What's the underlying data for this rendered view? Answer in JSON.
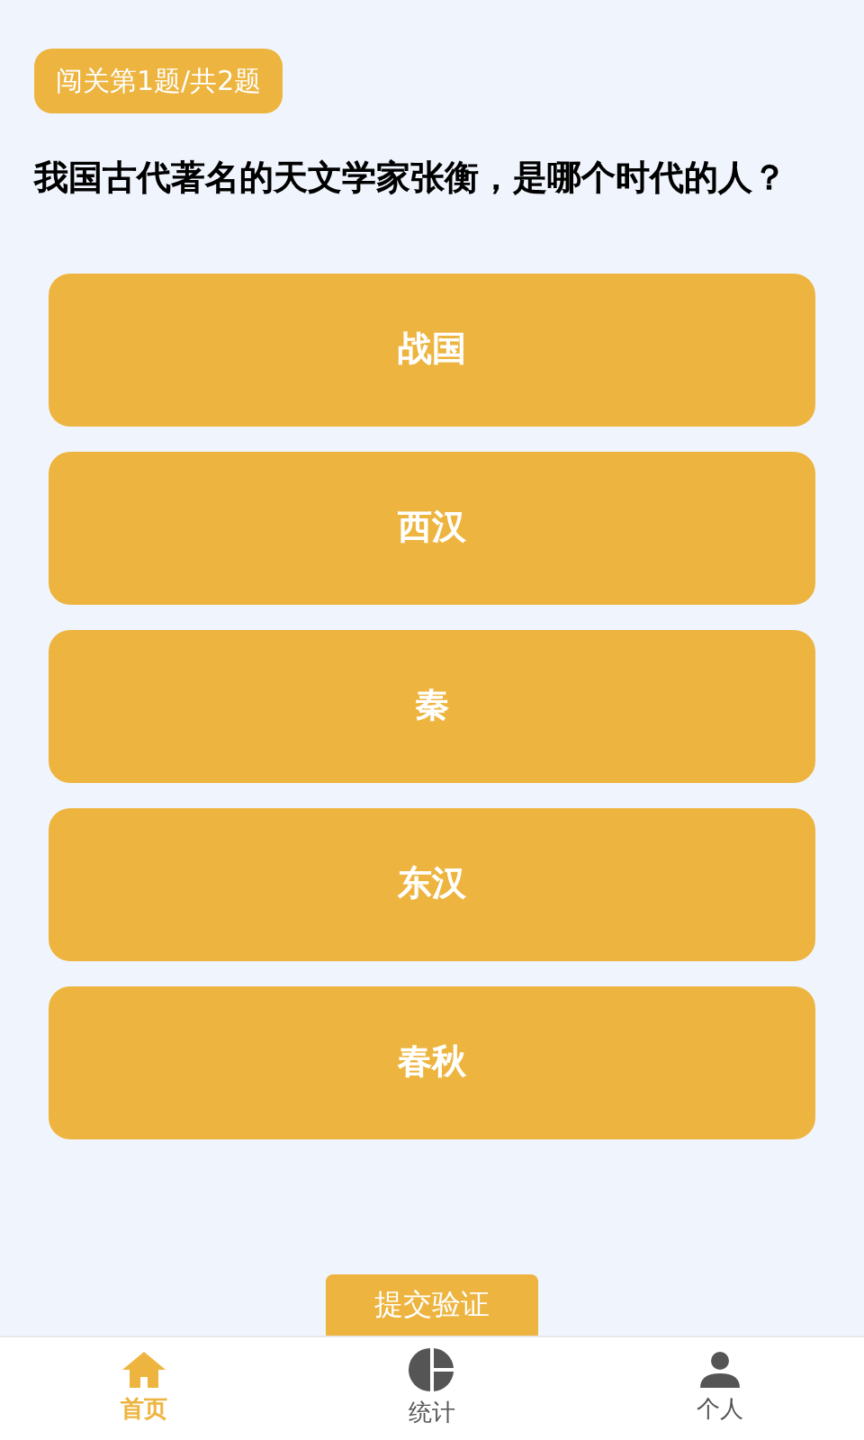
{
  "progress_badge": "闯关第1题/共2题",
  "question": "我国古代著名的天文学家张衡，是哪个时代的人？",
  "options": [
    {
      "label": "战国",
      "selected": false
    },
    {
      "label": "西汉",
      "selected": false
    },
    {
      "label": "秦",
      "selected": false
    },
    {
      "label": "东汉",
      "selected": false
    },
    {
      "label": "春秋",
      "selected": false
    }
  ],
  "submit_button": "提交验证",
  "tab_bar": [
    {
      "label": "首页",
      "kind": "home",
      "selected": true
    },
    {
      "label": "统计",
      "kind": "stats",
      "selected": false
    },
    {
      "label": "个人",
      "kind": "person",
      "selected": false
    }
  ]
}
